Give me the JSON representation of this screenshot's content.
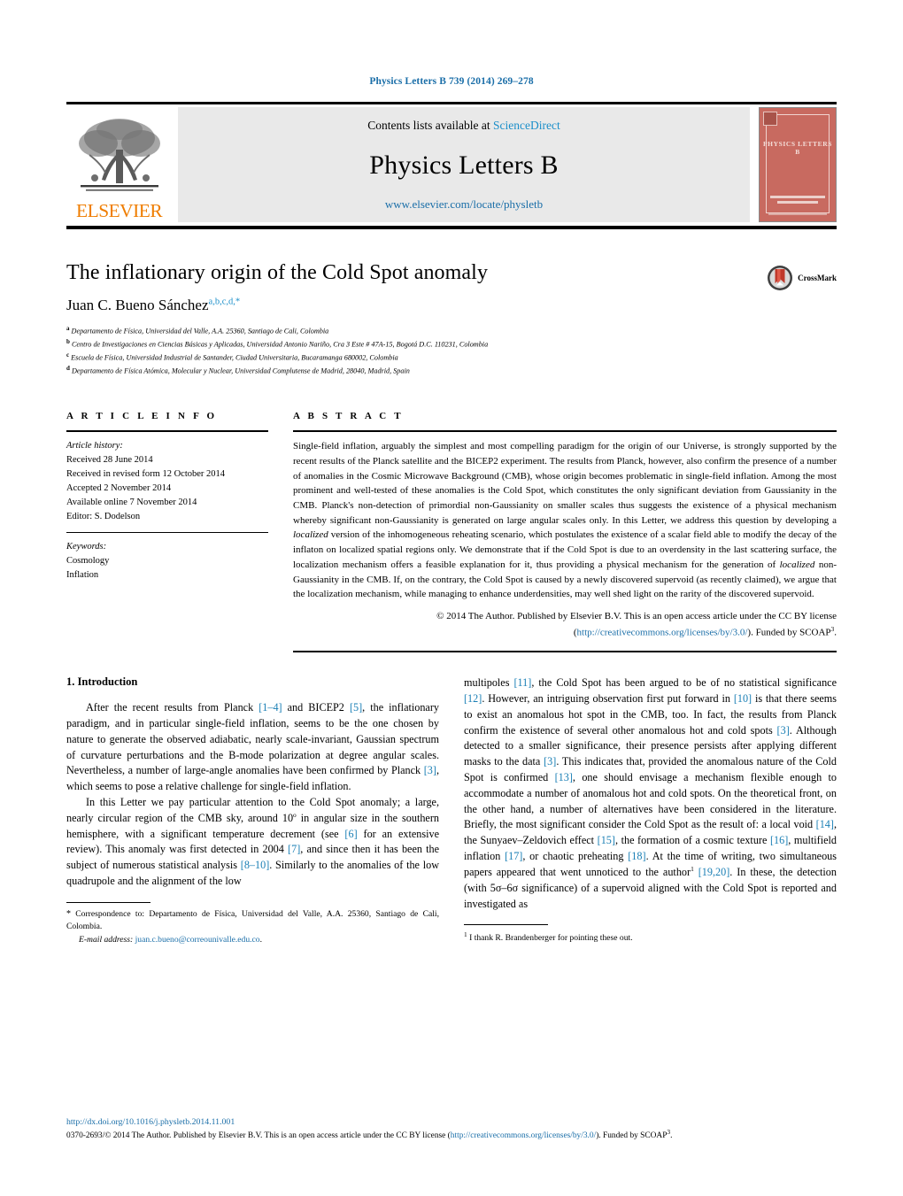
{
  "running_head": "Physics Letters B 739 (2014) 269–278",
  "masthead": {
    "contents_prefix": "Contents lists available at ",
    "contents_link": "ScienceDirect",
    "journal_title": "Physics Letters B",
    "journal_url": "www.elsevier.com/locate/physletb",
    "publisher_name": "ELSEVIER",
    "cover_label": "PHYSICS LETTERS B"
  },
  "title": "The inflationary origin of the Cold Spot anomaly",
  "author": {
    "name": "Juan C. Bueno Sánchez",
    "marks": "a,b,c,d,*"
  },
  "affiliations": [
    {
      "mark": "a",
      "text": "Departamento de Física, Universidad del Valle, A.A. 25360, Santiago de Cali, Colombia"
    },
    {
      "mark": "b",
      "text": "Centro de Investigaciones en Ciencias Básicas y Aplicadas, Universidad Antonio Nariño, Cra 3 Este # 47A-15, Bogotá D.C. 110231, Colombia"
    },
    {
      "mark": "c",
      "text": "Escuela de Física, Universidad Industrial de Santander, Ciudad Universitaria, Bucaramanga 680002, Colombia"
    },
    {
      "mark": "d",
      "text": "Departamento de Física Atómica, Molecular y Nuclear, Universidad Complutense de Madrid, 28040, Madrid, Spain"
    }
  ],
  "crossmark_label": "CrossMark",
  "article_info": {
    "heading": "A R T I C L E   I N F O",
    "history_label": "Article history:",
    "history": [
      "Received 28 June 2014",
      "Received in revised form 12 October 2014",
      "Accepted 2 November 2014",
      "Available online 7 November 2014",
      "Editor: S. Dodelson"
    ],
    "keywords_label": "Keywords:",
    "keywords": [
      "Cosmology",
      "Inflation"
    ]
  },
  "abstract": {
    "heading": "A B S T R A C T",
    "part1": "Single-field inflation, arguably the simplest and most compelling paradigm for the origin of our Universe, is strongly supported by the recent results of the Planck satellite and the BICEP2 experiment. The results from Planck, however, also confirm the presence of a number of anomalies in the Cosmic Microwave Background (CMB), whose origin becomes problematic in single-field inflation. Among the most prominent and well-tested of these anomalies is the Cold Spot, which constitutes the only significant deviation from Gaussianity in the CMB. Planck's non-detection of primordial non-Gaussianity on smaller scales thus suggests the existence of a physical mechanism whereby significant non-Gaussianity is generated on large angular scales only. In this Letter, we address this question by developing a ",
    "em1": "localized",
    "part2": " version of the inhomogeneous reheating scenario, which postulates the existence of a scalar field able to modify the decay of the inflaton on localized spatial regions only. We demonstrate that if the Cold Spot is due to an overdensity in the last scattering surface, the localization mechanism offers a feasible explanation for it, thus providing a physical mechanism for the generation of ",
    "em2": "localized",
    "part3": " non-Gaussianity in the CMB. If, on the contrary, the Cold Spot is caused by a newly discovered supervoid (as recently claimed), we argue that the localization mechanism, while managing to enhance underdensities, may well shed light on the rarity of the discovered supervoid.",
    "copyright_pre": "© 2014 The Author. Published by Elsevier B.V. This is an open access article under the CC BY license (",
    "copyright_link": "http://creativecommons.org/licenses/by/3.0/",
    "copyright_post": "). Funded by SCOAP",
    "copyright_sup": "3",
    "copyright_end": "."
  },
  "section": {
    "number_title": "1. Introduction"
  },
  "left_column": {
    "p1_a": "After the recent results from Planck ",
    "p1_r1": "[1–4]",
    "p1_b": " and BICEP2 ",
    "p1_r2": "[5]",
    "p1_c": ", the inflationary paradigm, and in particular single-field inflation, seems to be the one chosen by nature to generate the observed adiabatic, nearly scale-invariant, Gaussian spectrum of curvature perturbations and the B-mode polarization at degree angular scales. Nevertheless, a number of large-angle anomalies have been confirmed by Planck ",
    "p1_r3": "[3]",
    "p1_d": ", which seems to pose a relative challenge for single-field inflation.",
    "p2_a": "In this Letter we pay particular attention to the Cold Spot anomaly; a large, nearly circular region of the CMB sky, around 10",
    "p2_deg": "o",
    "p2_b": " in angular size in the southern hemisphere, with a significant temperature decrement (see ",
    "p2_r1": "[6]",
    "p2_c": " for an extensive review). This anomaly was first detected in 2004 ",
    "p2_r2": "[7]",
    "p2_d": ", and since then it has been the subject of numerous statistical analysis ",
    "p2_r3": "[8–10]",
    "p2_e": ". Similarly to the anomalies of the low quadrupole and the alignment of the low"
  },
  "right_column": {
    "p_a": "multipoles ",
    "p_r1": "[11]",
    "p_b": ", the Cold Spot has been argued to be of no statistical significance ",
    "p_r2": "[12]",
    "p_c": ". However, an intriguing observation first put forward in ",
    "p_r3": "[10]",
    "p_d": " is that there seems to exist an anomalous hot spot in the CMB, too. In fact, the results from Planck confirm the existence of several other anomalous hot and cold spots ",
    "p_r4": "[3]",
    "p_e": ". Although detected to a smaller significance, their presence persists after applying different masks to the data ",
    "p_r5": "[3]",
    "p_f": ". This indicates that, provided the anomalous nature of the Cold Spot is confirmed ",
    "p_r6": "[13]",
    "p_g": ", one should envisage a mechanism flexible enough to accommodate a number of anomalous hot and cold spots. On the theoretical front, on the other hand, a number of alternatives have been considered in the literature. Briefly, the most significant consider the Cold Spot as the result of: a local void ",
    "p_r7": "[14]",
    "p_h": ", the Sunyaev–Zeldovich effect ",
    "p_r8": "[15]",
    "p_i": ", the formation of a cosmic texture ",
    "p_r9": "[16]",
    "p_j": ", multifield inflation ",
    "p_r10": "[17]",
    "p_k": ", or chaotic preheating ",
    "p_r11": "[18]",
    "p_l": ". At the time of writing, two simultaneous papers appeared that went unnoticed to the author",
    "p_fnmark": "1",
    "p_m": " ",
    "p_r12": "[19,20]",
    "p_n": ". In these, the detection (with 5σ–6σ significance) of a supervoid aligned with the Cold Spot is reported and investigated as"
  },
  "footnote_left": {
    "star": "*",
    "text": " Correspondence to: Departamento de Física, Universidad del Valle, A.A. 25360, Santiago de Cali, Colombia.",
    "email_label": "E-mail address:",
    "email": "juan.c.bueno@correounivalle.edu.co"
  },
  "footnote_right": {
    "mark": "1",
    "text": " I thank R. Brandenberger for pointing these out."
  },
  "bottom": {
    "doi": "http://dx.doi.org/10.1016/j.physletb.2014.11.001",
    "issn_pre": "0370-2693/© 2014 The Author. Published by Elsevier B.V. This is an open access article under the CC BY license (",
    "issn_link": "http://creativecommons.org/licenses/by/3.0/",
    "issn_post": "). Funded by SCOAP",
    "issn_sup": "3",
    "issn_end": "."
  },
  "colors": {
    "link": "#1a6ea8",
    "reference": "#1a7fb5",
    "elsevier_orange": "#ef7d00",
    "cover_red": "#c86a60"
  }
}
